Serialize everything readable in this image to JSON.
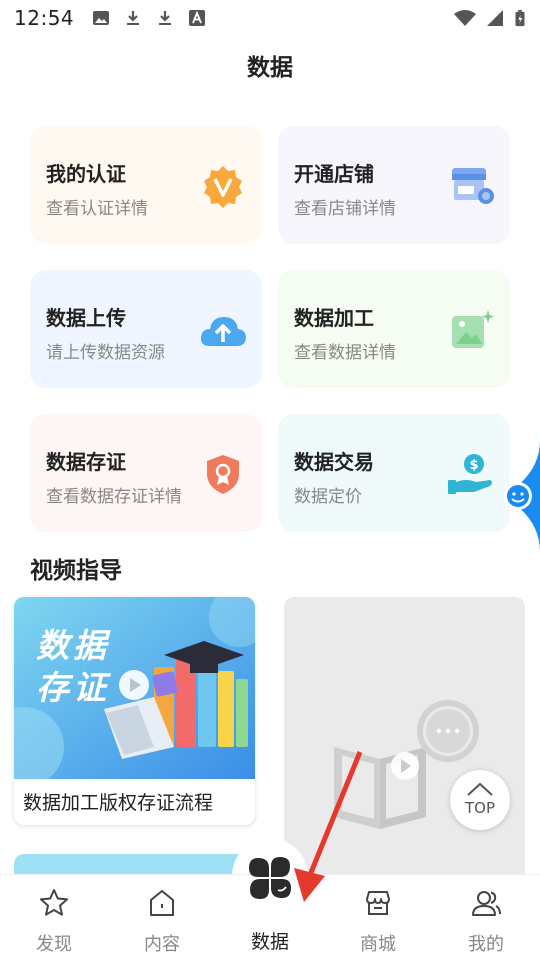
{
  "status_bar": {
    "time": "12:54",
    "left_icons": [
      "image-icon",
      "download-icon",
      "download-icon",
      "text-a-icon"
    ],
    "right_icons": [
      "wifi-icon",
      "signal-icon",
      "battery-charging-icon"
    ]
  },
  "page": {
    "title": "数据"
  },
  "cards": [
    {
      "title": "我的认证",
      "subtitle": "查看认证详情",
      "icon": "verified-badge-icon",
      "bg": "#fff9f1",
      "accent": "#f8a83c"
    },
    {
      "title": "开通店铺",
      "subtitle": "查看店铺详情",
      "icon": "store-icon",
      "bg": "#f6f6fc",
      "accent": "#5c8fe8"
    },
    {
      "title": "数据上传",
      "subtitle": "请上传数据资源",
      "icon": "cloud-upload-icon",
      "bg": "#f0f6ff",
      "accent": "#4aa8f0"
    },
    {
      "title": "数据加工",
      "subtitle": "查看数据详情",
      "icon": "image-sparkle-icon",
      "bg": "#f5fcf2",
      "accent": "#7bd08a"
    },
    {
      "title": "数据存证",
      "subtitle": "查看数据存证详情",
      "icon": "certificate-shield-icon",
      "bg": "#fdf6f5",
      "accent": "#f07a5c"
    },
    {
      "title": "数据交易",
      "subtitle": "数据定价",
      "icon": "money-hand-icon",
      "bg": "#f0fafa",
      "accent": "#2fb6d6"
    }
  ],
  "video_section": {
    "title": "视频指导",
    "videos": [
      {
        "caption": "数据加工版权存证流程",
        "thumb_text_line1": "数据",
        "thumb_text_line2": "存证"
      },
      {
        "caption": ""
      }
    ],
    "top_button_label": "TOP"
  },
  "bottom_nav": {
    "items": [
      {
        "label": "发现",
        "icon": "star-icon",
        "active": false
      },
      {
        "label": "内容",
        "icon": "home-icon",
        "active": false
      },
      {
        "label": "数据",
        "icon": "clover-icon",
        "active": true
      },
      {
        "label": "商城",
        "icon": "shop-icon",
        "active": false
      },
      {
        "label": "我的",
        "icon": "user-group-icon",
        "active": false
      }
    ]
  },
  "colors": {
    "side_tab": "#1a8cf0",
    "annotation_arrow": "#e5392e"
  }
}
